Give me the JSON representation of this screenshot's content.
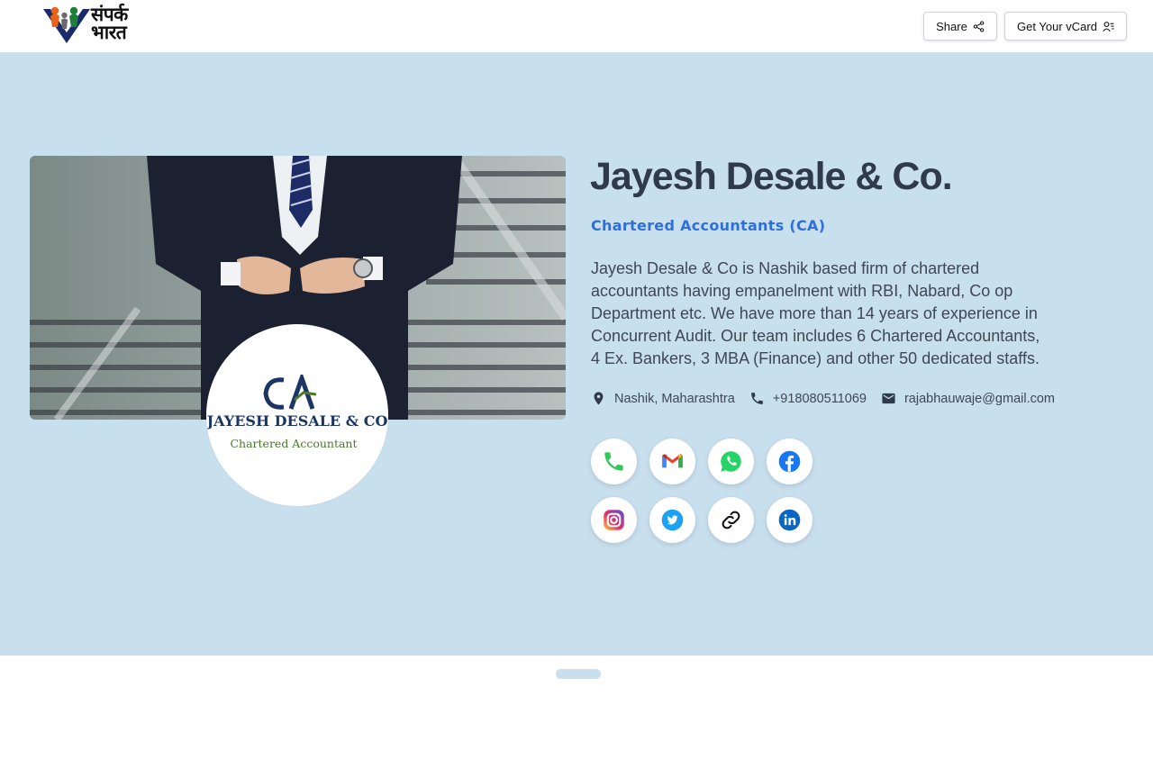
{
  "header": {
    "logo_text_line1": "संपर्क",
    "logo_text_line2": "भारत",
    "share_label": "Share",
    "vcard_label": "Get Your vCard"
  },
  "profile": {
    "name": "Jayesh Desale & Co.",
    "category": "Chartered Accountants (CA)",
    "description": "Jayesh Desale & Co is Nashik based firm of chartered accountants having empanelment with RBI, Nabard, Co op Department etc. We have more than 14 years of experience in Concurrent Audit. Our team includes 6 Chartered Accountants, 4 Ex. Bankers, 3 MBA (Finance) and other 50 dedicated staffs.",
    "location": "Nashik, Maharashtra",
    "phone": "+918080511069",
    "email": "rajabhauwaje@gmail.com"
  },
  "avatar_logo": {
    "mark": "CA",
    "firm": "JAYESH DESALE & CO",
    "tagline": "Chartered Accountant"
  },
  "social": [
    {
      "name": "phone-icon",
      "color": "#34c759"
    },
    {
      "name": "gmail-icon",
      "color": "#ea4335"
    },
    {
      "name": "whatsapp-icon",
      "color": "#25d366"
    },
    {
      "name": "facebook-icon",
      "color": "#1877f2"
    },
    {
      "name": "instagram-icon",
      "color": "#c13584"
    },
    {
      "name": "twitter-icon",
      "color": "#1da1f2"
    },
    {
      "name": "link-icon",
      "color": "#111111"
    },
    {
      "name": "linkedin-icon",
      "color": "#0a66c2"
    }
  ],
  "colors": {
    "hero_bg": "#c8dfee",
    "title": "#2f3a4c",
    "accent": "#2f6fdc"
  }
}
